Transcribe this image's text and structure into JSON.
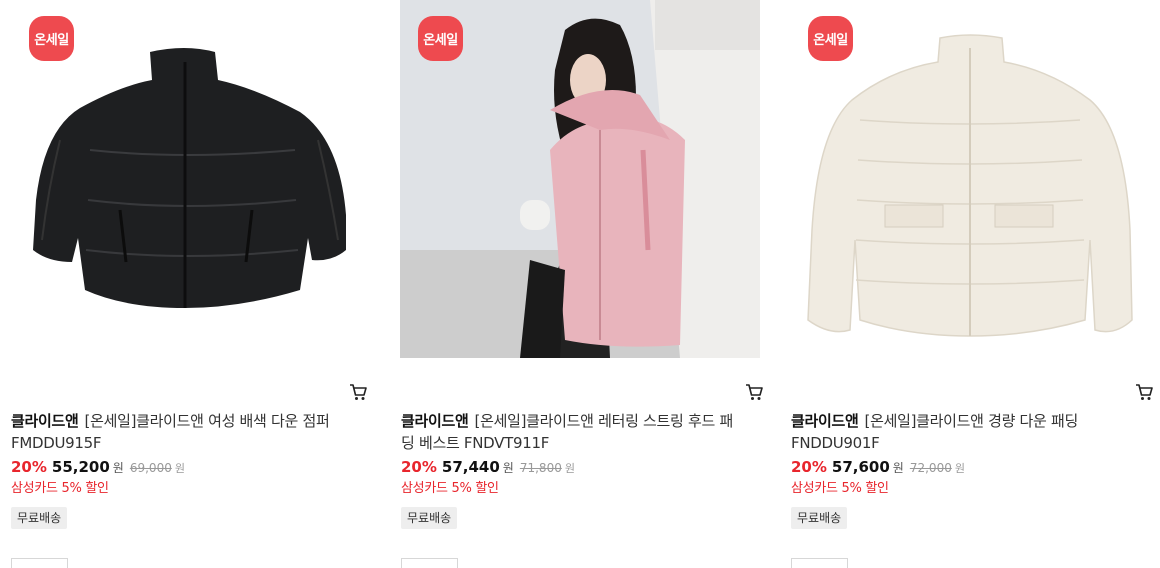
{
  "products": [
    {
      "badge": "온세일",
      "brand": "클라이드앤",
      "name": "[온세일]클라이드앤 여성 배색 다운 점퍼 FMDDU915F",
      "discount": "20%",
      "price": "55,200",
      "currency": "원",
      "original_price": "69,000",
      "original_currency": "원",
      "promo": "삼성카드 5% 할인",
      "shipping": "무료배송",
      "image": "black-puffer-jacket"
    },
    {
      "badge": "온세일",
      "brand": "클라이드앤",
      "name": "[온세일]클라이드앤 레터링 스트링 후드 패딩 베스트 FNDVT911F",
      "discount": "20%",
      "price": "57,440",
      "currency": "원",
      "original_price": "71,800",
      "original_currency": "원",
      "promo": "삼성카드 5% 할인",
      "shipping": "무료배송",
      "image": "pink-hooded-padded-vest-model"
    },
    {
      "badge": "온세일",
      "brand": "클라이드앤",
      "name": "[온세일]클라이드앤 경량 다운 패딩 FNDDU901F",
      "discount": "20%",
      "price": "57,600",
      "currency": "원",
      "original_price": "72,000",
      "original_currency": "원",
      "promo": "삼성카드 5% 할인",
      "shipping": "무료배송",
      "image": "ivory-lightweight-down-jacket"
    }
  ],
  "icons": {
    "cart": "cart-icon"
  },
  "colors": {
    "sale_badge": "#ee4a4f",
    "discount": "#e8262d",
    "promo": "#e8262d"
  }
}
